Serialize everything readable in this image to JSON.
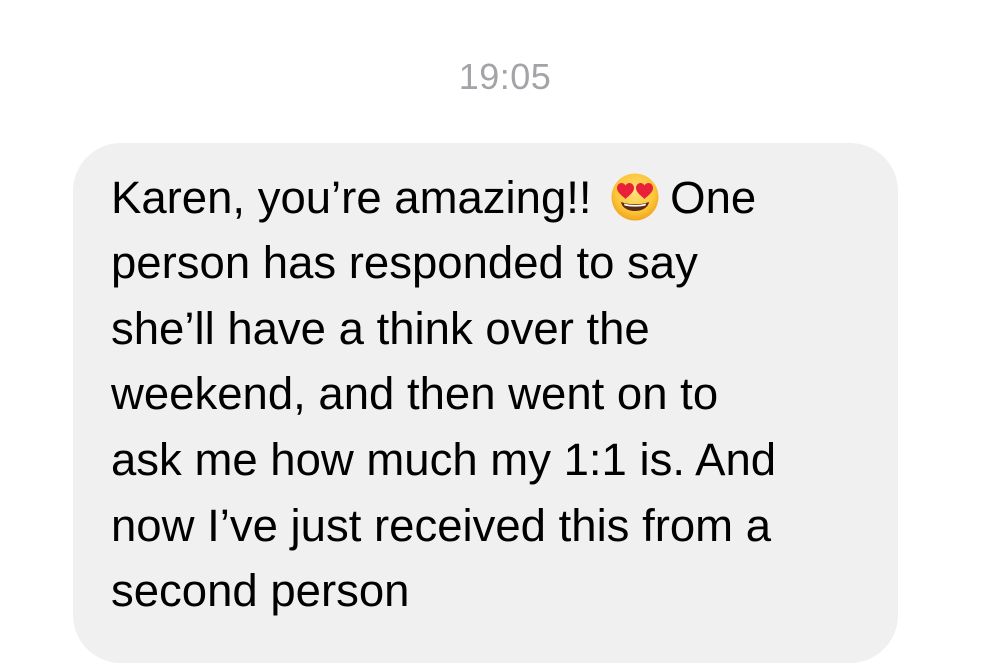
{
  "timestamp": "19:05",
  "message": {
    "line1_before_emoji": "Karen, you’re amazing!! ",
    "emoji_icon": "heart-eyes-emoji",
    "line1_after_emoji": "One",
    "line2": "person has responded to say",
    "line3": "she’ll have a think over the",
    "line4": "weekend, and then went on to",
    "line5": "ask me how much my 1:1 is. And",
    "line6": "now I’ve just received this from a",
    "line7": "second person"
  },
  "colors": {
    "bubble": "#f0f0f1",
    "timestamp": "#a3a3a8",
    "text": "#000000"
  }
}
